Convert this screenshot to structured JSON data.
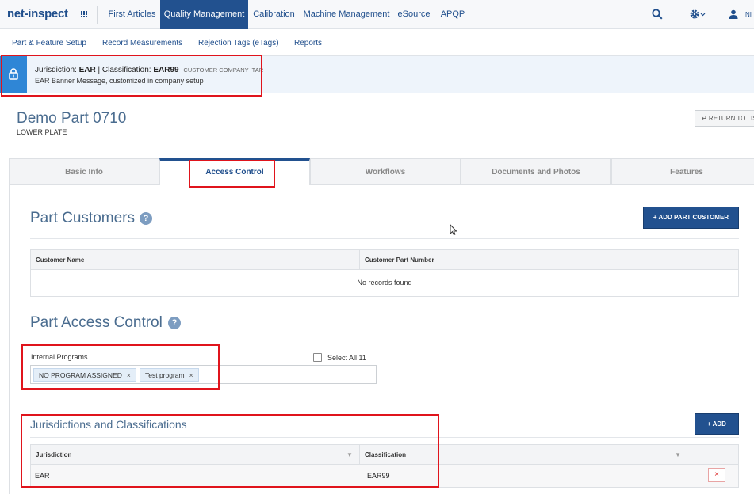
{
  "app": {
    "logo_text": "net-inspect",
    "user_initials": "NI"
  },
  "nav": {
    "items": [
      {
        "label": "First Articles",
        "active": false
      },
      {
        "label": "Quality Management",
        "active": true
      },
      {
        "label": "Calibration",
        "active": false
      },
      {
        "label": "Machine Management",
        "active": false
      },
      {
        "label": "eSource",
        "active": false
      },
      {
        "label": "APQP",
        "active": false
      }
    ],
    "search_icon": "search-icon",
    "settings_icon": "gear-icon",
    "user_icon": "user-icon"
  },
  "subnav": {
    "items": [
      {
        "label": "Part & Feature Setup"
      },
      {
        "label": "Record Measurements"
      },
      {
        "label": "Rejection Tags (eTags)"
      },
      {
        "label": "Reports"
      }
    ]
  },
  "banner": {
    "jurisdiction_label": "Jurisdiction:",
    "jurisdiction_value": "EAR",
    "classification_label": "Classification:",
    "classification_value": "EAR99",
    "tag": "CUSTOMER COMPANY ITAR",
    "message": "EAR Banner Message, customized in company setup",
    "icon": "lock-icon",
    "accent_color": "#2f86d6"
  },
  "part": {
    "title": "Demo Part 0710",
    "subtitle": "LOWER PLATE",
    "return_label": "↵ RETURN TO LIST"
  },
  "tabs": [
    {
      "label": "Basic Info",
      "active": false
    },
    {
      "label": "Access Control",
      "active": true
    },
    {
      "label": "Workflows",
      "active": false
    },
    {
      "label": "Documents and Photos",
      "active": false
    },
    {
      "label": "Features",
      "active": false
    }
  ],
  "part_customers": {
    "title": "Part Customers",
    "add_button": "+ ADD PART CUSTOMER",
    "columns": [
      "Customer Name",
      "Customer Part Number"
    ],
    "empty_text": "No records found"
  },
  "access_control": {
    "title": "Part Access Control",
    "internal_programs_label": "Internal Programs",
    "chips": [
      "NO PROGRAM ASSIGNED",
      "Test program"
    ],
    "select_all_label": "Select All 11"
  },
  "jurisdictions": {
    "title": "Jurisdictions and Classifications",
    "add_button": "+ ADD",
    "columns": [
      "Jurisdiction",
      "Classification"
    ],
    "rows": [
      {
        "jurisdiction": "EAR",
        "classification": "EAR99"
      }
    ],
    "delete_glyph": "×"
  },
  "colors": {
    "primary": "#22518f",
    "title_blue": "#4a6c8f",
    "highlight_red": "#e0141c"
  }
}
